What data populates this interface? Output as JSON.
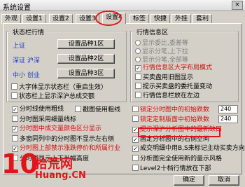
{
  "window": {
    "title": "系统设置",
    "close_label": "×"
  },
  "tabs": [
    "外观",
    "设置1",
    "设置2",
    "设置3",
    "设置4",
    "标签",
    "快捷",
    "外挂",
    "套利"
  ],
  "status_group": {
    "title": "状态栏行情",
    "rows": [
      {
        "label": "上证",
        "button": "设置品种1区"
      },
      {
        "label": "深证 沪深",
        "button": "设置品种2区"
      },
      {
        "label": "中小 创业",
        "button": "设置品种3区"
      }
    ],
    "checks": [
      {
        "label": "大字体显示状态栏（重启生效）",
        "checked": false
      },
      {
        "label": "状态栏上显示深沪总成交额",
        "checked": false
      }
    ]
  },
  "info_group": {
    "title": "行情信息区",
    "radios": [
      "显示委比,委差等",
      "显示分笔,上下拉",
      "显示分笔,全部等"
    ],
    "checks": [
      {
        "label": "行情信息区大字布局模式",
        "checked": true,
        "red": true
      },
      {
        "label": "买卖盘用旧图显示",
        "checked": false,
        "red": false
      },
      {
        "label": "提示买卖盘的委托量变动",
        "checked": false,
        "red": false
      },
      {
        "label": "行情信息栏放在左边",
        "checked": false,
        "red": false
      }
    ]
  },
  "left_checks": [
    {
      "label": "分时线使用粗线",
      "checked": true,
      "red": false
    },
    {
      "label": "分时图采用细量线标",
      "checked": false,
      "red": false
    },
    {
      "label": "分时图中成交量颜色区分显示",
      "checked": true,
      "red": true
    },
    {
      "label": "多窗同列中的分时图不显示左右侧",
      "checked": false,
      "red": false
    },
    {
      "label": "分时图上部禁示涨跌停价和所属行业",
      "checked": true,
      "red": true
    },
    {
      "label": "分时图显示上下半幅高度",
      "checked": false,
      "red": false
    }
  ],
  "left_extra": {
    "label": "戳图使用粗线",
    "checked": false
  },
  "right_checks": [
    {
      "label": "锁定分时图中的初始跌数",
      "checked": false,
      "red": true,
      "value": "240"
    },
    {
      "label": "锁定定制版面中初始跌数",
      "checked": false,
      "red": true,
      "value": "240"
    },
    {
      "label": "提示深沪分析图中的最新缺口",
      "checked": true,
      "red": true
    },
    {
      "label": "固定分析图中的右侧空间",
      "checked": true,
      "red": false
    },
    {
      "label": "成交明细中用B,S来标记主动买卖方向",
      "checked": true,
      "red": false
    },
    {
      "label": "分析图完全使用新的量示风格",
      "checked": false,
      "red": false
    },
    {
      "label": "Level2十档行情放在下部",
      "checked": false,
      "red": false
    }
  ],
  "bottom": {
    "ok": "确定",
    "cancel": "取消"
  },
  "watermark": {
    "number": "10",
    "name": "拾荒网",
    "url": "Huang.CN"
  },
  "colors": {
    "accent_red": "#e2141a",
    "link_blue": "#1a3fc4"
  }
}
